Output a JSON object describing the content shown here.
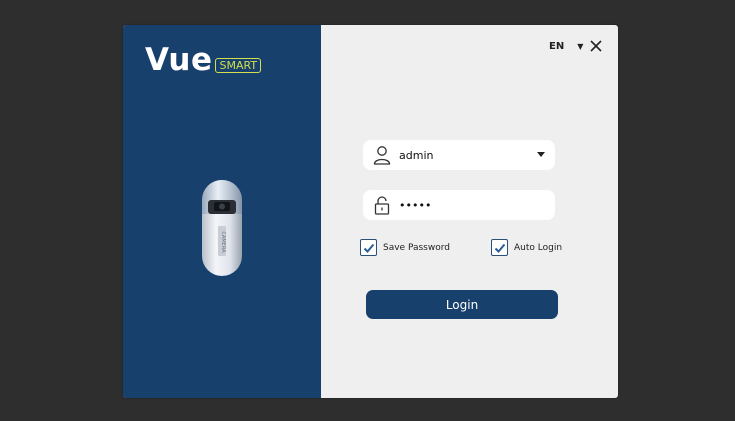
{
  "logo": {
    "main": "Vue",
    "badge": "SMART"
  },
  "language": {
    "selected": "EN"
  },
  "login_form": {
    "username": {
      "value": "admin",
      "icon": "user-icon"
    },
    "password": {
      "value": "•••••",
      "icon": "lock-icon"
    },
    "save_password": {
      "label": "Save Password",
      "checked": true
    },
    "auto_login": {
      "label": "Auto Login",
      "checked": true
    },
    "submit_label": "Login"
  },
  "colors": {
    "brand_blue": "#17406c",
    "badge_yellow": "#d4df4f",
    "panel_bg": "#efefef",
    "backdrop": "#2e2e2e"
  }
}
